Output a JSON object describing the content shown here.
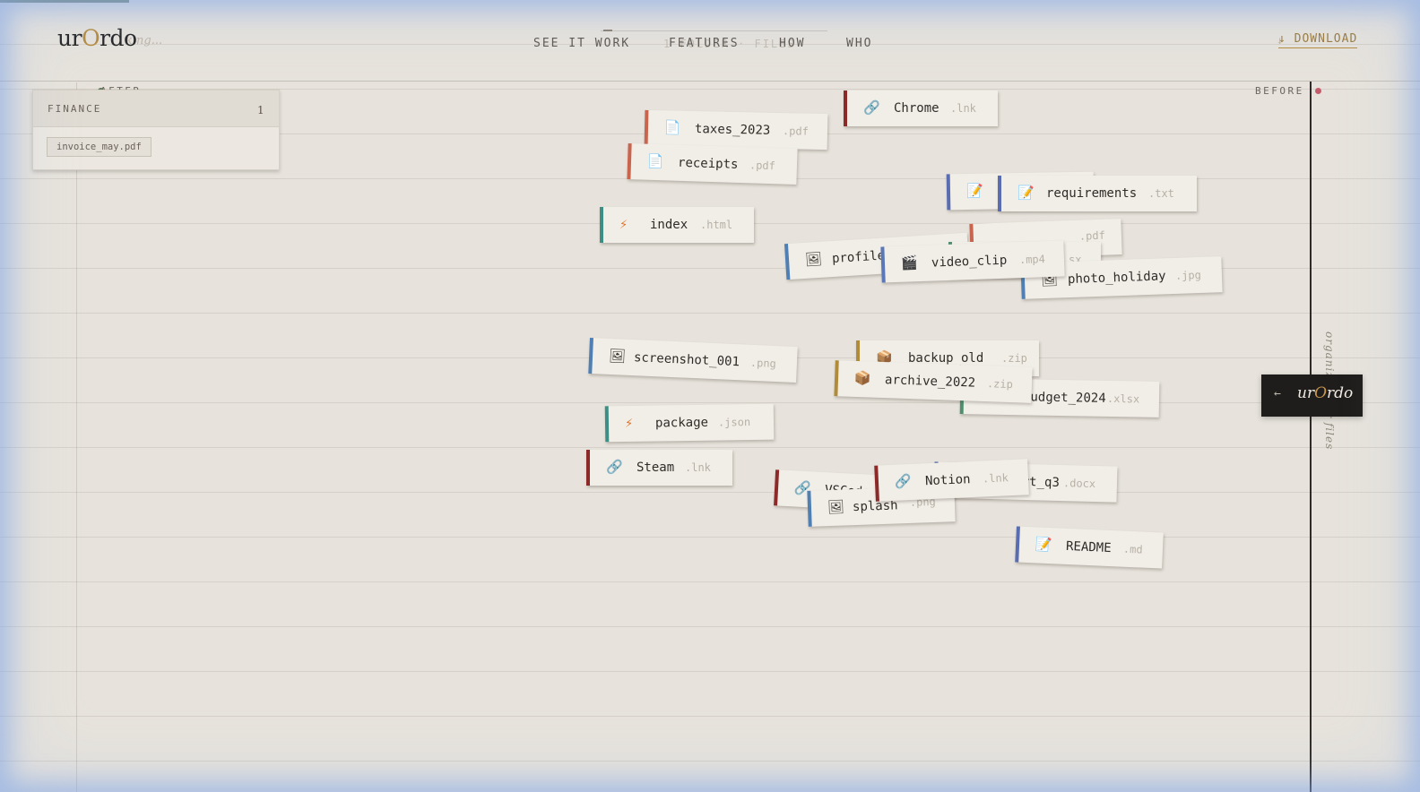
{
  "app": {
    "logo_prefix": "ur",
    "logo_accent": "O",
    "logo_suffix": "rdo",
    "logo_ghost": "king..."
  },
  "nav": {
    "items": [
      "SEE IT WORK",
      "FEATURES",
      "HOW",
      "WHO"
    ],
    "ghost_text": "1 FOLDER · FILES",
    "download_label": "↓ DOWNLOAD",
    "download_ghost": "↓"
  },
  "labels": {
    "before": "BEFORE",
    "after": "AFTER",
    "side_text": "organize your files",
    "handle_arrow": "←",
    "handle_brand_prefix": "ur",
    "handle_brand_accent": "O",
    "handle_brand_suffix": "rdo"
  },
  "folder": {
    "title": "FINANCE",
    "count": "1",
    "files": [
      "invoice_may.pdf"
    ]
  },
  "files": [
    {
      "name": "taxes_2023",
      "ext": ".pdf",
      "icon": "document-icon",
      "glyph": "📄"
    },
    {
      "name": "receipts",
      "ext": ".pdf",
      "icon": "document-icon",
      "glyph": "📄"
    },
    {
      "name": "Chrome",
      "ext": ".lnk",
      "icon": "link-icon",
      "glyph": "🔗"
    },
    {
      "name": "index",
      "ext": ".html",
      "icon": "lightning-icon",
      "glyph": "⚡"
    },
    {
      "name": "",
      "ext": "",
      "icon": "note-icon",
      "glyph": "📝"
    },
    {
      "name": "requirements",
      "ext": ".txt",
      "icon": "note-icon",
      "glyph": "📝"
    },
    {
      "name": "",
      "ext": ".pdf",
      "icon": "document-icon",
      "glyph": ""
    },
    {
      "name": "profile",
      "ext": "",
      "icon": "image-icon",
      "glyph": "🖼"
    },
    {
      "name": "",
      "ext": "sx",
      "icon": "spreadsheet-icon",
      "glyph": ""
    },
    {
      "name": "photo_holiday",
      "ext": ".jpg",
      "icon": "image-icon",
      "glyph": "🖼"
    },
    {
      "name": "video_clip",
      "ext": ".mp4",
      "icon": "clapperboard-icon",
      "glyph": "🎬"
    },
    {
      "name": "screenshot_001",
      "ext": ".png",
      "icon": "image-icon",
      "glyph": "🖼"
    },
    {
      "name": "backup_old",
      "ext": ".zip",
      "icon": "package-icon",
      "glyph": "📦"
    },
    {
      "name": "budget_2024",
      "ext": ".xlsx",
      "icon": "spreadsheet-icon",
      "glyph": "📊"
    },
    {
      "name": "archive_2022",
      "ext": ".zip",
      "icon": "package-icon",
      "glyph": "📦"
    },
    {
      "name": "package",
      "ext": ".json",
      "icon": "lightning-icon",
      "glyph": "⚡"
    },
    {
      "name": "Steam",
      "ext": ".lnk",
      "icon": "link-icon",
      "glyph": "🔗"
    },
    {
      "name": "report_q3",
      "ext": ".docx",
      "icon": "document-icon",
      "glyph": "📄"
    },
    {
      "name": "VSCode",
      "ext": ".lnk",
      "icon": "link-icon",
      "glyph": "🔗"
    },
    {
      "name": "splash",
      "ext": ".png",
      "icon": "image-icon",
      "glyph": "🖼"
    },
    {
      "name": "Notion",
      "ext": ".lnk",
      "icon": "link-icon",
      "glyph": "🔗"
    },
    {
      "name": "README",
      "ext": ".md",
      "icon": "note-icon",
      "glyph": "📝"
    }
  ],
  "colors": {
    "background": "#e7e3dc",
    "accent_gold": "#b58a3c",
    "before_dot": "#c45c6c",
    "after_dot": "#5d7d5a",
    "stripe_pdf": "#c9654f",
    "stripe_link": "#8c2a2a",
    "stripe_code": "#3d8f86",
    "stripe_image": "#4f7fb3",
    "stripe_doc": "#5a6db0",
    "stripe_zip": "#b08c3a",
    "stripe_sheet": "#4f8f6f",
    "stripe_video": "#5a78b8"
  }
}
